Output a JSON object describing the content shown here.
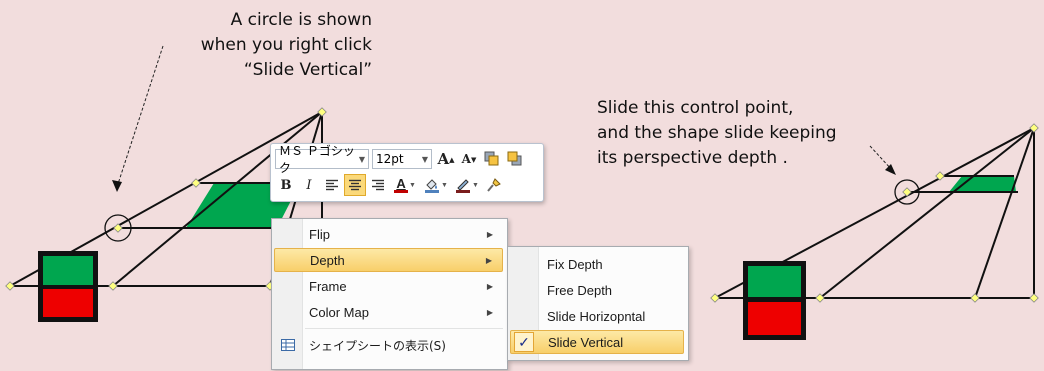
{
  "notes": {
    "left": [
      "A circle is shown",
      "when you right click",
      "“Slide Vertical”"
    ],
    "right": [
      "Slide this control point,",
      "and the shape slide keeping",
      "its perspective depth ."
    ]
  },
  "mini_toolbar": {
    "font_name": "ＭＳ Ｐゴシック",
    "font_size": "12pt",
    "grow_font": "A",
    "shrink_font": "A",
    "bold": "B",
    "italic": "I",
    "font_color_letter": "A",
    "font_color": "#c00000",
    "fill_color": "#4f81bd",
    "line_color": "#7a1d1d"
  },
  "context_menu": {
    "items": [
      {
        "label": "Flip",
        "has_submenu": true
      },
      {
        "label": "Depth",
        "has_submenu": true,
        "highlighted": true
      },
      {
        "label": "Frame",
        "has_submenu": true
      },
      {
        "label": "Color Map",
        "has_submenu": true
      },
      {
        "label": "シェイプシートの表示(S)",
        "has_submenu": false,
        "icon": "shapesheet-icon"
      }
    ]
  },
  "submenu": {
    "items": [
      {
        "label": "Fix Depth"
      },
      {
        "label": "Free Depth"
      },
      {
        "label": "Slide Horizopntal"
      },
      {
        "label": "Slide Vertical",
        "checked": true,
        "highlighted": true
      }
    ],
    "check_glyph": "✓"
  },
  "colors": {
    "background": "#f2dddd",
    "green": "#00a64f",
    "red": "#ee0000",
    "handle": "#ffff80"
  }
}
